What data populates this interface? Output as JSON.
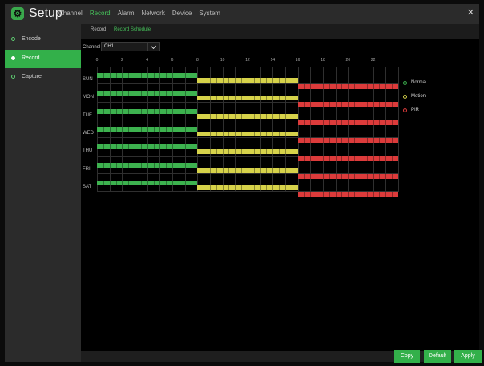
{
  "app": {
    "title": "Setup",
    "logo_icon": "gear-icon"
  },
  "topnav": [
    "Channel",
    "Record",
    "Alarm",
    "Network",
    "Device",
    "System"
  ],
  "topnav_active": "Record",
  "sidebar": {
    "items": [
      {
        "label": "Encode"
      },
      {
        "label": "Record"
      },
      {
        "label": "Capture"
      }
    ],
    "active": "Record"
  },
  "subtabs": [
    {
      "label": "Record"
    },
    {
      "label": "Record Schedule"
    }
  ],
  "subtab_active": "Record Schedule",
  "channel": {
    "label": "Channel",
    "value": "CH1"
  },
  "schedule": {
    "hour_labels": [
      "0",
      "2",
      "4",
      "6",
      "8",
      "10",
      "12",
      "14",
      "16",
      "18",
      "20",
      "22"
    ],
    "days": [
      "SUN",
      "MON",
      "TUE",
      "WED",
      "THU",
      "FRI",
      "SAT"
    ],
    "blocks": [
      {
        "type": "normal",
        "start": 0,
        "end": 8
      },
      {
        "type": "motion",
        "start": 8,
        "end": 16
      },
      {
        "type": "pir",
        "start": 16,
        "end": 24
      }
    ]
  },
  "legend": [
    {
      "label": "Normal",
      "color": "#3db24f"
    },
    {
      "label": "Motion",
      "color": "#d6d24a"
    },
    {
      "label": "PIR",
      "color": "#dc3b3b"
    }
  ],
  "buttons": {
    "copy": "Copy",
    "default": "Default",
    "apply": "Apply"
  },
  "close_icon": "close-icon"
}
